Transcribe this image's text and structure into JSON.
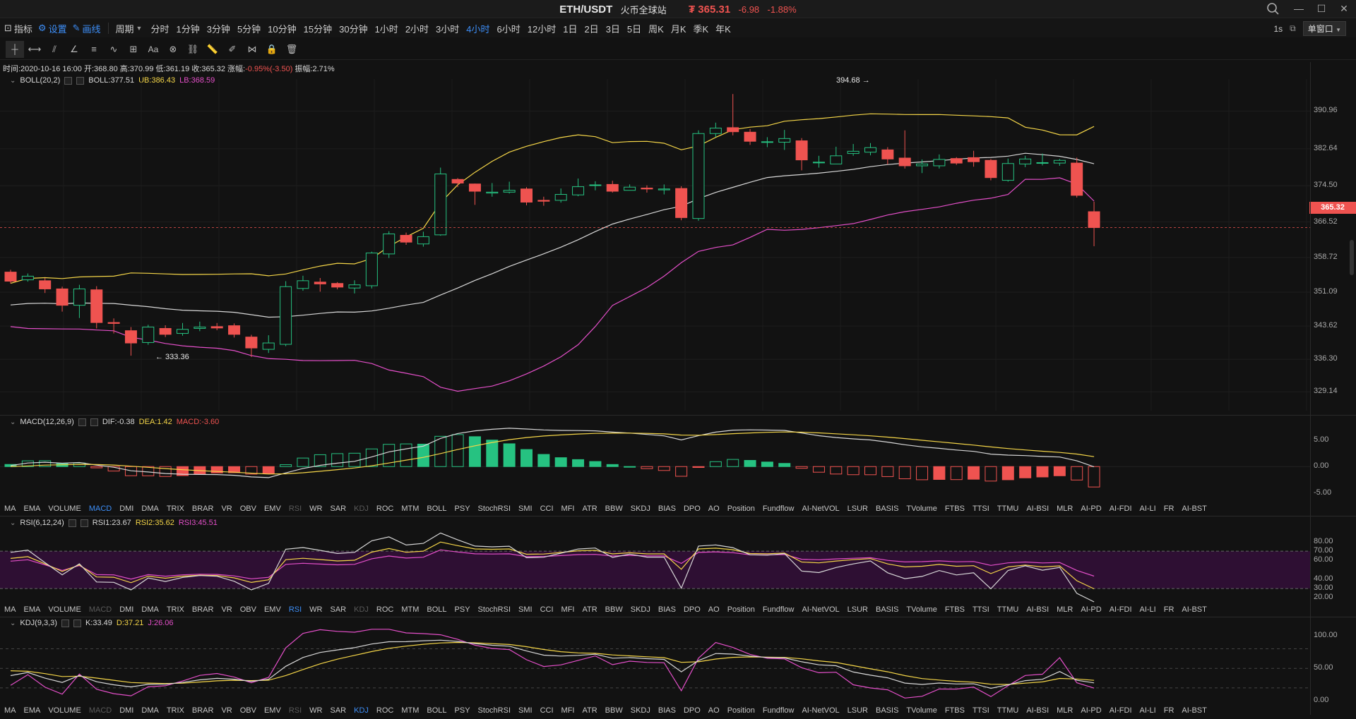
{
  "titlebar": {
    "pair": "ETH/USDT",
    "exchange": "火币全球站",
    "price": "₮ 365.31",
    "change": "-6.98",
    "change_pct": "-1.88%"
  },
  "menu": {
    "indicators": "指标",
    "settings": "设置",
    "draw": "画线",
    "period": "周期"
  },
  "periods": [
    "分时",
    "1分钟",
    "3分钟",
    "5分钟",
    "10分钟",
    "15分钟",
    "30分钟",
    "1小时",
    "2小时",
    "3小时",
    "4小时",
    "6小时",
    "12小时",
    "1日",
    "2日",
    "3日",
    "5日",
    "周K",
    "月K",
    "季K",
    "年K"
  ],
  "active_period": "4小时",
  "refresh": "1s",
  "window_mode": "单窗口",
  "ohlc": {
    "time": "时间:2020-10-16 16:00",
    "open": "开:368.80",
    "high": "高:370.99",
    "low": "低:361.19",
    "close": "收:365.32",
    "change_label": "涨幅:",
    "change_val": "-0.95%(-3.50)",
    "amp": "振幅:2.71%"
  },
  "boll": {
    "name": "BOLL(20,2)",
    "mid": "BOLL:377.51",
    "ub": "UB:386.43",
    "lb": "LB:368.59"
  },
  "macd": {
    "name": "MACD(12,26,9)",
    "dif": "DIF:-0.38",
    "dea": "DEA:1.42",
    "macd": "MACD:-3.60"
  },
  "rsi": {
    "name": "RSI(6,12,24)",
    "rsi1": "RSI1:23.67",
    "rsi2": "RSI2:35.62",
    "rsi3": "RSI3:45.51"
  },
  "kdj": {
    "name": "KDJ(9,3,3)",
    "k": "K:33.49",
    "d": "D:37.21",
    "j": "J:26.06"
  },
  "price_axis": [
    "390.96",
    "382.64",
    "374.50",
    "366.52",
    "358.72",
    "351.09",
    "343.62",
    "336.30",
    "329.14"
  ],
  "last_price_tag": "365.32",
  "annotations": {
    "high": "394.68 →",
    "low": "← 333.36"
  },
  "macd_axis": [
    "5.00",
    "0.00",
    "-5.00"
  ],
  "rsi_axis": [
    "80.00",
    "70.00",
    "60.00",
    "40.00",
    "30.00",
    "20.00"
  ],
  "kdj_axis": [
    "100.00",
    "50.00",
    "0.00"
  ],
  "indicator_tabs": [
    "MA",
    "EMA",
    "VOLUME",
    "MACD",
    "DMI",
    "DMA",
    "TRIX",
    "BRAR",
    "VR",
    "OBV",
    "EMV",
    "RSI",
    "WR",
    "SAR",
    "KDJ",
    "ROC",
    "MTM",
    "BOLL",
    "PSY",
    "StochRSI",
    "SMI",
    "CCI",
    "MFI",
    "ATR",
    "BBW",
    "SKDJ",
    "BIAS",
    "DPO",
    "AO",
    "Position",
    "Fundflow",
    "AI-NetVOL",
    "LSUR",
    "BASIS",
    "TVolume",
    "FTBS",
    "TTSI",
    "TTMU",
    "AI-BSI",
    "MLR",
    "AI-PD",
    "AI-FDI",
    "AI-LI",
    "FR",
    "AI-BST"
  ],
  "colors": {
    "up": "#26c281",
    "down": "#ef5350",
    "boll_mid": "#d8d8d8",
    "boll_ub": "#f5d648",
    "boll_lb": "#e44fc9",
    "accent": "#3d8ef7"
  },
  "candles": [
    [
      355.5,
      353.5,
      356,
      353
    ],
    [
      353.8,
      354.6,
      355.2,
      353.4
    ],
    [
      353.6,
      351.8,
      354.2,
      350.9
    ],
    [
      351.8,
      348.2,
      352.3,
      346.8
    ],
    [
      348.2,
      351.8,
      352.7,
      345.4
    ],
    [
      351.6,
      344.4,
      352.4,
      343.1
    ],
    [
      344.4,
      344.2,
      345.3,
      342
    ],
    [
      342.6,
      339.9,
      343.4,
      337.1
    ],
    [
      340,
      343.4,
      343.9,
      339.5
    ],
    [
      343.1,
      341.8,
      343.8,
      341.2
    ],
    [
      342,
      342.9,
      344.3,
      341.5
    ],
    [
      343.1,
      343.4,
      344.6,
      342.5
    ],
    [
      343.5,
      343.2,
      344.3,
      342.7
    ],
    [
      343.7,
      341.8,
      344.2,
      341.1
    ],
    [
      341.2,
      338.8,
      341.7,
      336.8
    ],
    [
      338.5,
      339.9,
      341.6,
      337.7
    ],
    [
      339.6,
      352.3,
      353.5,
      339.2
    ],
    [
      351.9,
      353.6,
      354.7,
      351.4
    ],
    [
      353.3,
      352.9,
      354.2,
      351.2
    ],
    [
      353,
      352.2,
      353.3,
      351.7
    ],
    [
      352,
      352.7,
      353.7,
      350.8
    ],
    [
      352.5,
      359.7,
      360,
      351.9
    ],
    [
      359.5,
      363.9,
      364.5,
      358.6
    ],
    [
      363.6,
      362.1,
      364.2,
      361.5
    ],
    [
      361.7,
      363.3,
      364.4,
      361.1
    ],
    [
      363.7,
      377.1,
      378.5,
      363.5
    ],
    [
      375.9,
      375.1,
      376.2,
      374.2
    ],
    [
      374.9,
      373.3,
      375,
      370.3
    ],
    [
      372.9,
      373.1,
      375.1,
      372.1
    ],
    [
      373.1,
      373.5,
      375.4,
      372.8
    ],
    [
      373.8,
      370.9,
      374.2,
      370.2
    ],
    [
      371.3,
      371.1,
      372.1,
      370.1
    ],
    [
      371.3,
      372.6,
      373.9,
      370.8
    ],
    [
      372.5,
      374.3,
      376.1,
      372.2
    ],
    [
      374.6,
      374.7,
      375.5,
      373.5
    ],
    [
      374.8,
      373.3,
      375.6,
      373
    ],
    [
      373.5,
      374.2,
      374.8,
      373.5
    ],
    [
      374,
      373.8,
      374.6,
      373
    ],
    [
      373.6,
      373.8,
      374.8,
      372.6
    ],
    [
      373.9,
      367.5,
      374.4,
      366.9
    ],
    [
      367.3,
      386,
      386.7,
      366.8
    ],
    [
      386,
      387.2,
      388.4,
      385.2
    ],
    [
      387.3,
      386.4,
      394.7,
      385.6
    ],
    [
      386.3,
      384.3,
      387,
      383.5
    ],
    [
      384.1,
      384.2,
      385.2,
      383
    ],
    [
      384.1,
      384.9,
      386.8,
      382.4
    ],
    [
      384.4,
      380.2,
      385,
      377.9
    ],
    [
      379.7,
      379.7,
      381.1,
      378.5
    ],
    [
      379.3,
      381.1,
      383.1,
      379.3
    ],
    [
      381.6,
      382.1,
      383.7,
      381.1
    ],
    [
      381.9,
      382.9,
      383.9,
      381.2
    ],
    [
      382.4,
      380.4,
      383,
      379.2
    ],
    [
      380.6,
      378.9,
      386.7,
      378.3
    ],
    [
      378.9,
      379.3,
      380.3,
      377.3
    ],
    [
      378.9,
      380.3,
      381.4,
      378.3
    ],
    [
      380.5,
      379.5,
      380.8,
      379.1
    ],
    [
      380.7,
      379.8,
      382.2,
      378.7
    ],
    [
      380.1,
      376.3,
      380.4,
      375.7
    ],
    [
      375.7,
      379.4,
      380.5,
      375.4
    ],
    [
      379.3,
      380.4,
      381.1,
      378.6
    ],
    [
      379.6,
      379.6,
      381.6,
      379
    ],
    [
      379.5,
      380.1,
      380.4,
      378.9
    ],
    [
      379.5,
      372.4,
      380.7,
      371.9
    ],
    [
      368.8,
      365.3,
      371,
      361.2
    ]
  ]
}
